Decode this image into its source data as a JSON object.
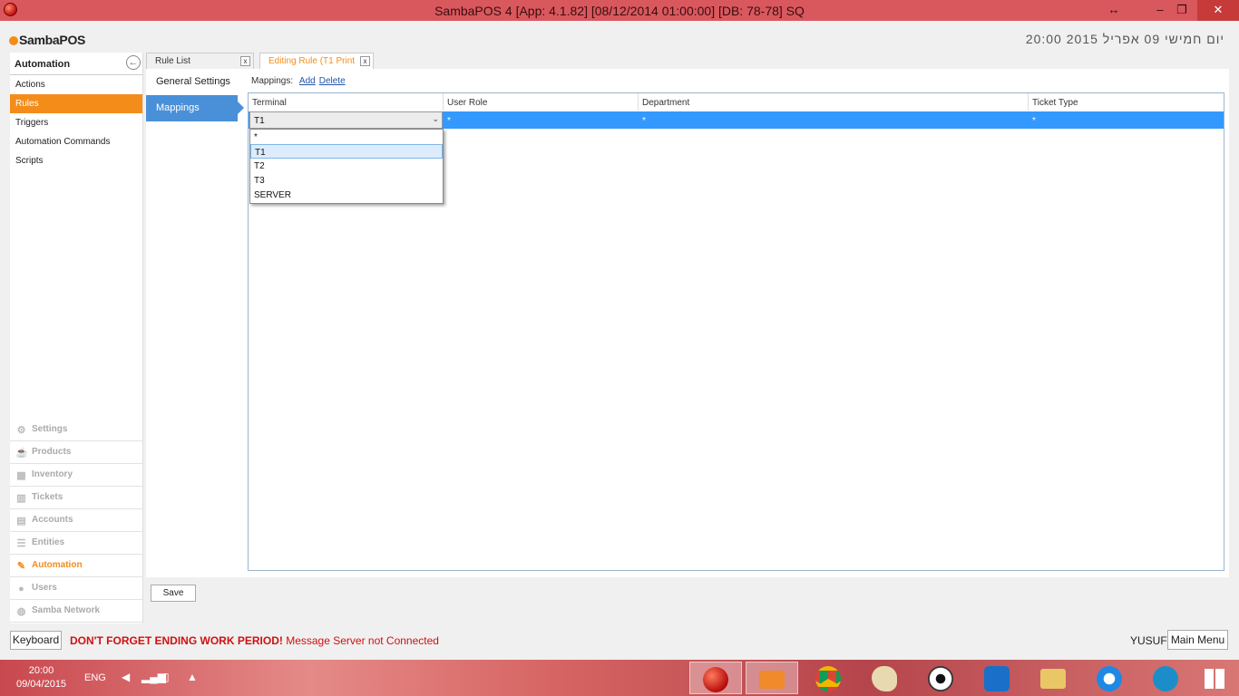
{
  "window": {
    "title": "SambaPOS 4 [App: 4.1.82] [08/12/2014 01:00:00] [DB: 78-78] SQ",
    "controls": {
      "resize": "↔",
      "minimize": "–",
      "maximize": "❐",
      "close": "✕"
    }
  },
  "header": {
    "logo": "SambaPOS",
    "datetime": "יום חמישי 09 אפריל 2015  20:00"
  },
  "leftnav": {
    "title": "Automation",
    "items": [
      {
        "label": "Actions",
        "active": false
      },
      {
        "label": "Rules",
        "active": true
      },
      {
        "label": "Triggers",
        "active": false
      },
      {
        "label": "Automation Commands",
        "active": false
      },
      {
        "label": "Scripts",
        "active": false
      }
    ],
    "modules": [
      {
        "label": "Settings",
        "icon": "gear-icon",
        "glyph": "⚙",
        "active": false
      },
      {
        "label": "Products",
        "icon": "cup-icon",
        "glyph": "☕",
        "active": false
      },
      {
        "label": "Inventory",
        "icon": "boxes-icon",
        "glyph": "▦",
        "active": false
      },
      {
        "label": "Tickets",
        "icon": "ticket-icon",
        "glyph": "▥",
        "active": false
      },
      {
        "label": "Accounts",
        "icon": "calculator-icon",
        "glyph": "▤",
        "active": false
      },
      {
        "label": "Entities",
        "icon": "list-icon",
        "glyph": "☰",
        "active": false
      },
      {
        "label": "Automation",
        "icon": "pencil-icon",
        "glyph": "✎",
        "active": true
      },
      {
        "label": "Users",
        "icon": "user-icon",
        "glyph": "●",
        "active": false
      },
      {
        "label": "Samba Network",
        "icon": "globe-icon",
        "glyph": "◍",
        "active": false
      }
    ]
  },
  "tabs": [
    {
      "label": "Rule List",
      "close": "x",
      "active": false
    },
    {
      "label": "Editing Rule (T1 Print",
      "close": "x",
      "active": true
    }
  ],
  "subnav": [
    {
      "label": "General Settings",
      "active": false
    },
    {
      "label": "Mappings",
      "active": true
    }
  ],
  "mappings": {
    "label": "Mappings:",
    "add": "Add",
    "delete": "Delete"
  },
  "grid": {
    "columns": [
      "Terminal",
      "User Role",
      "Department",
      "Ticket Type"
    ],
    "rows": [
      {
        "terminal": "T1",
        "user_role": "*",
        "department": "*",
        "ticket_type": "*"
      }
    ],
    "terminal_options": [
      "*",
      "T1",
      "T2",
      "T3",
      "SERVER"
    ],
    "selected_option": "T1"
  },
  "save_label": "Save",
  "statusbar": {
    "keyboard": "Keyboard",
    "warning": "DON'T FORGET ENDING WORK PERIOD!",
    "message": "Message Server not Connected",
    "user": "YUSUF",
    "main_menu": "Main Menu"
  },
  "taskbar": {
    "time": "20:00",
    "date": "09/04/2015",
    "language": "ENG"
  },
  "colors": {
    "accent": "#f48c1a",
    "selection": "#3399ff",
    "titlebar": "#d9585e",
    "subnav_active": "#4a90d9"
  }
}
